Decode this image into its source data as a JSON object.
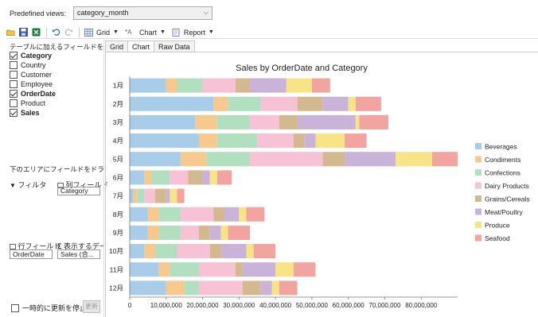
{
  "predefined_views": {
    "label": "Predefined views:",
    "value": "category_month"
  },
  "toolbar": {
    "grid_label": "Grid",
    "chart_label": "Chart",
    "report_label": "Report",
    "chart_icon_text": "*A"
  },
  "field_panel": {
    "title": "テーブルに加えるフィールドを選択して",
    "fields": [
      {
        "label": "Category",
        "checked": true,
        "bold": true
      },
      {
        "label": "Country",
        "checked": false,
        "bold": false
      },
      {
        "label": "Customer",
        "checked": false,
        "bold": false
      },
      {
        "label": "Employee",
        "checked": false,
        "bold": false
      },
      {
        "label": "OrderDate",
        "checked": true,
        "bold": true
      },
      {
        "label": "Product",
        "checked": false,
        "bold": false
      },
      {
        "label": "Sales",
        "checked": true,
        "bold": true
      }
    ],
    "drag_title": "下のエリアにフィールドをドラッグして",
    "filter_label": "フィルタ",
    "column_label": "列フィールド",
    "column_chip": "Category",
    "row_label": "行フィールド",
    "values_label": "表示するデー",
    "row_chip": "OrderDate",
    "values_chip": "Sales (合...",
    "defer_label": "一時的に更新を停止...",
    "update_button": "更新"
  },
  "tabs": [
    "Grid",
    "Chart",
    "Raw Data"
  ],
  "active_tab": "Chart",
  "colors": {
    "Beverages": "#a9cce9",
    "Condiments": "#f7c98f",
    "Confections": "#b2dfbf",
    "Dairy Products": "#f7c1d6",
    "Grains/Cereals": "#d2b990",
    "Meat/Poultry": "#c9b3d9",
    "Produce": "#f6e487",
    "Seafood": "#f2a5a0"
  },
  "chart_data": {
    "type": "bar",
    "orientation": "horizontal",
    "stacked": true,
    "title": "Sales by OrderDate and Category",
    "categories": [
      "1月",
      "2月",
      "3月",
      "4月",
      "5月",
      "6月",
      "7月",
      "8月",
      "9月",
      "10月",
      "11月",
      "12月"
    ],
    "xlim": [
      0,
      90000000
    ],
    "xticks": [
      "0",
      "10,000,000",
      "20,000,000",
      "30,000,000",
      "40,000,000",
      "50,000,000",
      "60,000,000",
      "70,000,000",
      "80,000,000"
    ],
    "legend_position": "right",
    "series": [
      {
        "name": "Beverages",
        "values": [
          10000000,
          23000000,
          18000000,
          19000000,
          14000000,
          4000000,
          1000000,
          5000000,
          5000000,
          4000000,
          8000000,
          10000000
        ]
      },
      {
        "name": "Condiments",
        "values": [
          3000000,
          4000000,
          6000000,
          5000000,
          7000000,
          2000000,
          1000000,
          3000000,
          3000000,
          3000000,
          3000000,
          5000000
        ]
      },
      {
        "name": "Confections",
        "values": [
          7000000,
          9000000,
          9000000,
          11000000,
          12000000,
          5000000,
          2000000,
          6000000,
          6000000,
          6000000,
          8000000,
          4000000
        ]
      },
      {
        "name": "Dairy Products",
        "values": [
          9000000,
          10000000,
          8000000,
          10000000,
          20000000,
          5000000,
          3000000,
          9000000,
          5000000,
          9000000,
          10000000,
          12000000
        ]
      },
      {
        "name": "Grains/Cereals",
        "values": [
          4000000,
          7000000,
          5000000,
          3000000,
          6000000,
          4000000,
          3000000,
          3000000,
          3000000,
          3000000,
          2000000,
          5000000
        ]
      },
      {
        "name": "Meat/Poultry",
        "values": [
          10000000,
          7000000,
          16000000,
          3000000,
          14000000,
          2000000,
          1000000,
          4000000,
          3000000,
          7000000,
          9000000,
          3000000
        ]
      },
      {
        "name": "Produce",
        "values": [
          7000000,
          2000000,
          1000000,
          8000000,
          10000000,
          2000000,
          2000000,
          2000000,
          2000000,
          2000000,
          5000000,
          2000000
        ]
      },
      {
        "name": "Seafood",
        "values": [
          5000000,
          7000000,
          8000000,
          6000000,
          7000000,
          4000000,
          2000000,
          5000000,
          6000000,
          6000000,
          6000000,
          5000000
        ]
      }
    ]
  }
}
